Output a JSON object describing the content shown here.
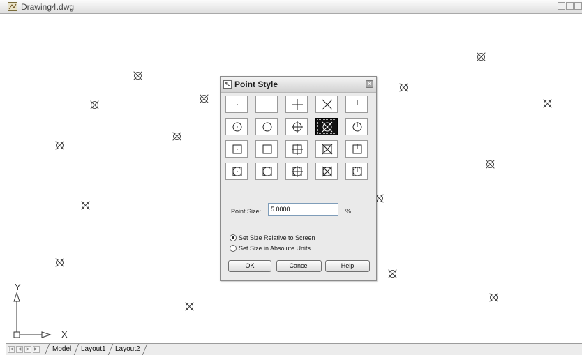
{
  "window": {
    "title": "Drawing4.dwg",
    "icon": "drawing-file-icon",
    "controls": [
      "minimize-icon",
      "restore-icon",
      "close-icon"
    ]
  },
  "canvas": {
    "point_style": "circle-x",
    "ucs": {
      "x_label": "X",
      "y_label": "Y"
    }
  },
  "tabs": {
    "nav": [
      "first-tab-icon",
      "prev-tab-icon",
      "next-tab-icon",
      "last-tab-icon"
    ],
    "items": [
      {
        "label": "Model",
        "active": true
      },
      {
        "label": "Layout1",
        "active": false
      },
      {
        "label": "Layout2",
        "active": false
      }
    ]
  },
  "dialog": {
    "title": "Point Style",
    "point_styles": [
      [
        "dot",
        "none",
        "plus",
        "x",
        "tick"
      ],
      [
        "circle-dot",
        "circle-none",
        "circle-plus",
        "circle-x",
        "circle-tick"
      ],
      [
        "square-dot",
        "square-none",
        "square-plus",
        "square-x",
        "square-tick"
      ],
      [
        "circle-square-dot",
        "circle-square-none",
        "circle-square-plus",
        "circle-square-x",
        "circle-square-tick"
      ]
    ],
    "selected_style": "circle-x",
    "point_size_label": "Point Size:",
    "point_size_value": "5.0000",
    "point_size_unit": "%",
    "radio_options": [
      {
        "label": "Set Size Relative to Screen",
        "selected": true
      },
      {
        "label": "Set Size in Absolute Units",
        "selected": false
      }
    ],
    "buttons": {
      "ok": "OK",
      "cancel": "Cancel",
      "help": "Help"
    }
  }
}
